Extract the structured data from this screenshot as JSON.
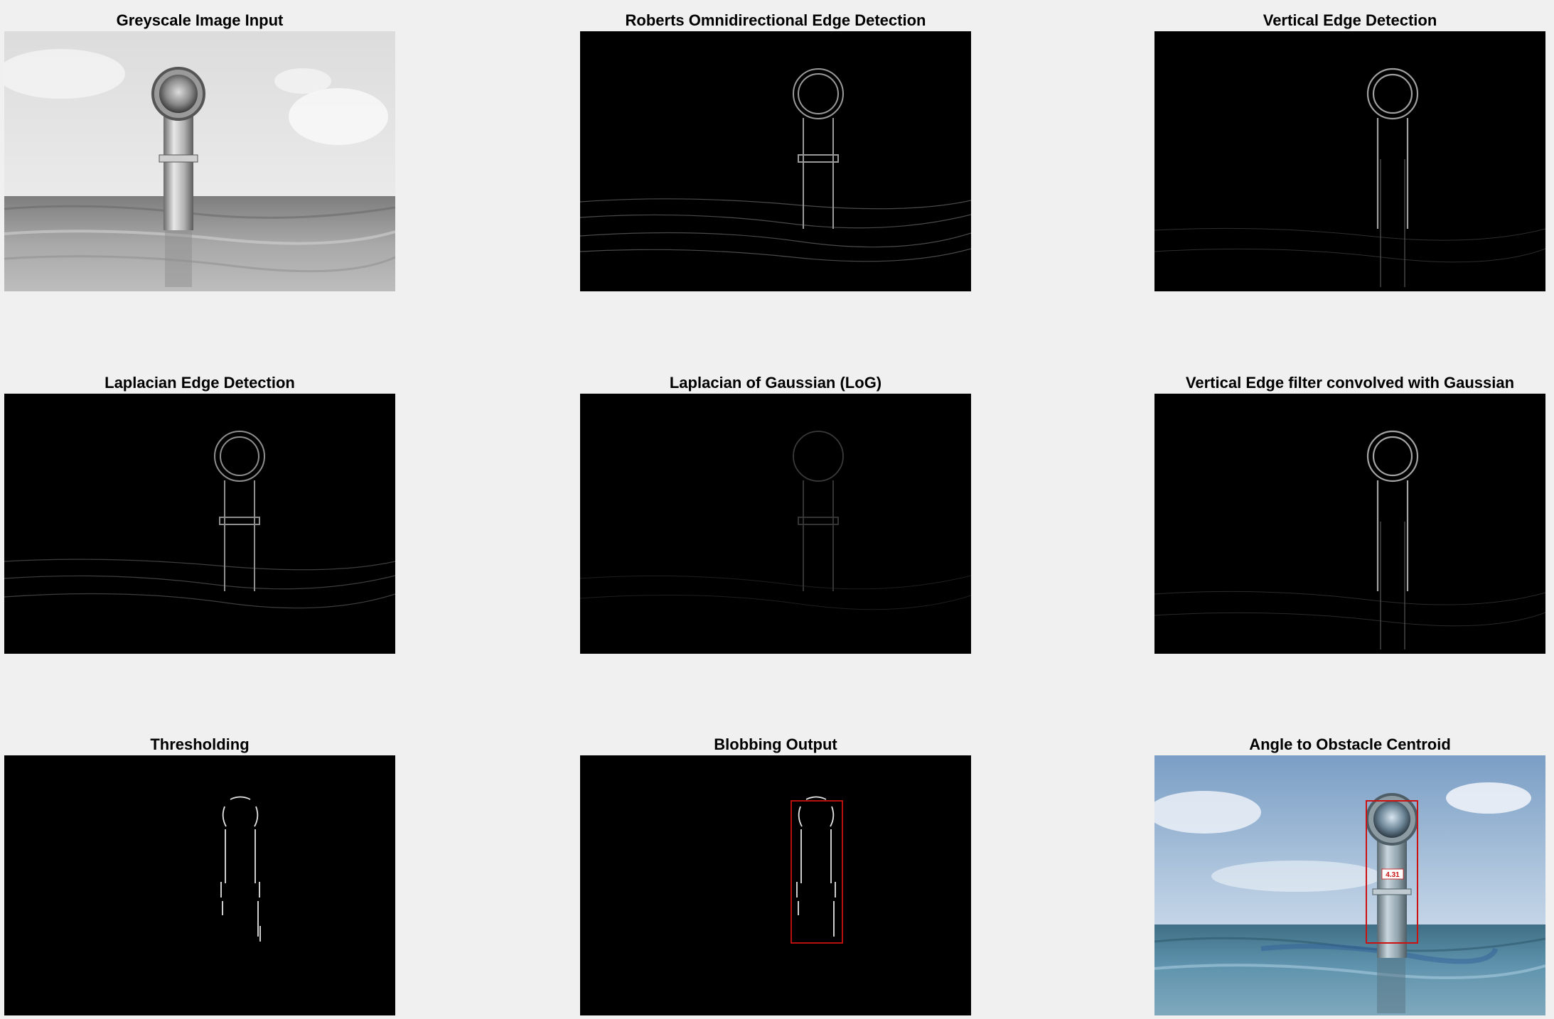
{
  "figure": {
    "panels": [
      {
        "title": "Greyscale Image Input"
      },
      {
        "title": "Roberts Omnidirectional Edge Detection"
      },
      {
        "title": "Vertical Edge Detection"
      },
      {
        "title": "Laplacian Edge Detection"
      },
      {
        "title": "Laplacian of Gaussian (LoG)"
      },
      {
        "title": "Vertical Edge filter convolved with Gaussian"
      },
      {
        "title": "Thresholding"
      },
      {
        "title": "Blobbing Output"
      },
      {
        "title": "Angle to Obstacle Centroid"
      }
    ],
    "angle_label": "4.31",
    "colors": {
      "background": "#f0f0f0",
      "bbox": "#cc1111"
    }
  }
}
